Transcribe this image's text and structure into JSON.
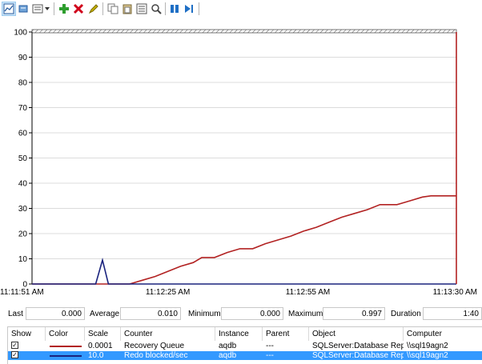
{
  "toolbar": {
    "buttons": [
      {
        "name": "view-graph-icon"
      },
      {
        "name": "freeze-display-icon"
      },
      {
        "name": "change-graph-type-icon"
      },
      {
        "name": "add-counter-icon"
      },
      {
        "name": "delete-counter-icon"
      },
      {
        "name": "highlight-icon"
      },
      {
        "name": "copy-properties-icon"
      },
      {
        "name": "paste-counter-list-icon"
      },
      {
        "name": "properties-icon"
      },
      {
        "name": "zoom-icon"
      },
      {
        "name": "pause-icon"
      },
      {
        "name": "update-data-icon"
      }
    ]
  },
  "graph": {
    "y_ticks": [
      "100",
      "90",
      "80",
      "70",
      "60",
      "50",
      "40",
      "30",
      "20",
      "10",
      "0"
    ],
    "x_ticks": [
      "11:11:51 AM",
      "11:12:25 AM",
      "11:12:55 AM",
      "11:13:30 AM"
    ]
  },
  "chart_data": {
    "type": "line",
    "ylim": [
      0,
      100
    ],
    "x": [
      "11:11:51 AM",
      "11:12:25 AM",
      "11:12:55 AM",
      "11:13:30 AM"
    ],
    "series": [
      {
        "name": "Recovery Queue",
        "color": "#b22222",
        "points": [
          [
            0,
            0
          ],
          [
            0.23,
            0
          ],
          [
            0.26,
            1.5
          ],
          [
            0.29,
            3
          ],
          [
            0.32,
            5
          ],
          [
            0.35,
            7
          ],
          [
            0.38,
            8.5
          ],
          [
            0.4,
            10.5
          ],
          [
            0.43,
            10.5
          ],
          [
            0.46,
            12.5
          ],
          [
            0.49,
            14
          ],
          [
            0.52,
            14
          ],
          [
            0.55,
            16
          ],
          [
            0.58,
            17.5
          ],
          [
            0.61,
            19
          ],
          [
            0.64,
            21
          ],
          [
            0.67,
            22.5
          ],
          [
            0.7,
            24.5
          ],
          [
            0.73,
            26.5
          ],
          [
            0.76,
            28
          ],
          [
            0.79,
            29.5
          ],
          [
            0.82,
            31.5
          ],
          [
            0.86,
            31.5
          ],
          [
            0.89,
            33
          ],
          [
            0.92,
            34.5
          ],
          [
            0.94,
            35
          ],
          [
            1,
            35
          ]
        ]
      },
      {
        "name": "Redo blocked/sec",
        "color": "#1a237e",
        "points": [
          [
            0,
            0
          ],
          [
            0.15,
            0
          ],
          [
            0.166,
            9.5
          ],
          [
            0.18,
            0
          ],
          [
            1,
            0
          ]
        ]
      }
    ]
  },
  "stats": {
    "last_label": "Last",
    "last_value": "0.000",
    "average_label": "Average",
    "average_value": "0.010",
    "minimum_label": "Minimum",
    "minimum_value": "0.000",
    "maximum_label": "Maximum",
    "maximum_value": "0.997",
    "duration_label": "Duration",
    "duration_value": "1:40"
  },
  "table": {
    "headers": {
      "show": "Show",
      "color": "Color",
      "scale": "Scale",
      "counter": "Counter",
      "instance": "Instance",
      "parent": "Parent",
      "object": "Object",
      "computer": "Computer"
    },
    "rows": [
      {
        "show": "✓",
        "color": "#b22222",
        "scale": "0.0001",
        "counter": "Recovery Queue",
        "instance": "aqdb",
        "parent": "---",
        "object": "SQLServer:Database Replica",
        "computer": "\\\\sql19agn2"
      },
      {
        "show": "✓",
        "color": "#1a237e",
        "scale": "10.0",
        "counter": "Redo blocked/sec",
        "instance": "aqdb",
        "parent": "---",
        "object": "SQLServer:Database Replica",
        "computer": "\\\\sql19agn2"
      }
    ]
  }
}
